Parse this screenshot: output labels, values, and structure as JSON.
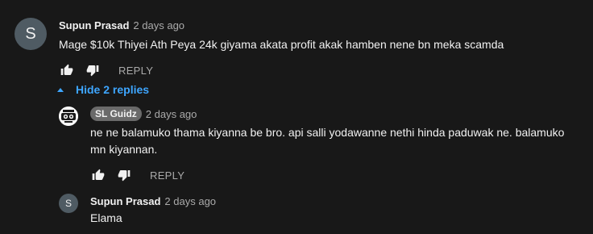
{
  "comments": [
    {
      "avatar_letter": "S",
      "author": "Supun Prasad",
      "time": "2 days ago",
      "text": "Mage $10k Thiyei Ath Peya 24k giyama akata profit akak hamben nene bn meka scamda",
      "reply_label": "REPLY"
    }
  ],
  "replies_toggle": {
    "label": "Hide 2 replies"
  },
  "replies": [
    {
      "author": "SL Guidz",
      "time": "2 days ago",
      "text_line1": "ne ne balamuko thama kiyanna be bro. api salli yodawanne nethi hinda paduwak ne. balamuko",
      "text_line2": "mn kiyannan.",
      "reply_label": "REPLY"
    },
    {
      "avatar_letter": "S",
      "author": "Supun Prasad",
      "time": "2 days ago",
      "text": "Elama"
    }
  ],
  "colors": {
    "background": "#181818",
    "text": "#f1f1f1",
    "muted": "#aaaaaa",
    "link": "#3ea6ff",
    "avatar": "#4f5b63"
  },
  "icons": [
    "thumbs-up-icon",
    "thumbs-down-icon",
    "caret-up-icon"
  ]
}
